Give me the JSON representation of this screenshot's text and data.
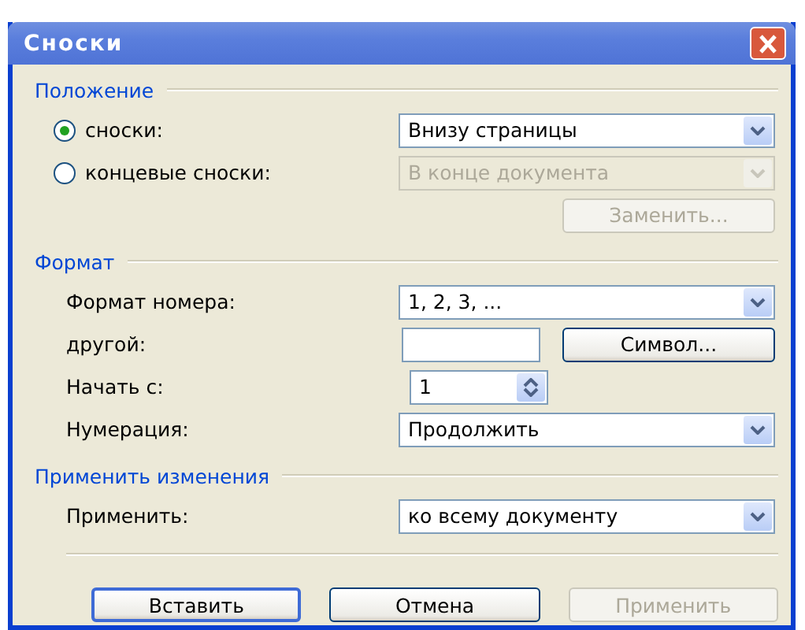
{
  "window": {
    "title": "Сноски"
  },
  "sections": [
    {
      "title": "Положение",
      "rows": [
        {
          "kind": "radio",
          "label": "сноски:",
          "selected": true,
          "controls": [
            {
              "kind": "dropdown",
              "value": "Внизу страницы",
              "disabled": false
            }
          ]
        },
        {
          "kind": "radio",
          "label": "концевые сноски:",
          "selected": false,
          "controls": [
            {
              "kind": "dropdown",
              "value": "В конце документа",
              "disabled": true
            }
          ]
        },
        {
          "kind": "actions",
          "controls": [
            {
              "kind": "button",
              "label": "Заменить...",
              "disabled": true
            }
          ]
        }
      ]
    },
    {
      "title": "Формат",
      "rows": [
        {
          "kind": "plain",
          "label": "Формат номера:",
          "controls": [
            {
              "kind": "dropdown",
              "value": "1, 2, 3, ...",
              "disabled": false
            }
          ]
        },
        {
          "kind": "plain",
          "label": "другой:",
          "controls": [
            {
              "kind": "input"
            },
            {
              "kind": "button",
              "label": "Символ...",
              "disabled": false
            }
          ]
        },
        {
          "kind": "plain",
          "label": "Начать с:",
          "controls": [
            {
              "kind": "spinner",
              "value": "1"
            }
          ]
        },
        {
          "kind": "plain",
          "label": "Нумерация:",
          "controls": [
            {
              "kind": "dropdown",
              "value": "Продолжить",
              "disabled": false
            }
          ]
        }
      ]
    },
    {
      "title": "Применить изменения",
      "rows": [
        {
          "kind": "plain",
          "label": "Применить:",
          "controls": [
            {
              "kind": "dropdown",
              "value": "ко всему документу",
              "disabled": false
            }
          ]
        }
      ]
    }
  ],
  "buttons": [
    {
      "label": "Вставить",
      "default": true,
      "disabled": false
    },
    {
      "label": "Отмена",
      "default": false,
      "disabled": false
    },
    {
      "label": "Применить",
      "default": false,
      "disabled": true
    }
  ]
}
